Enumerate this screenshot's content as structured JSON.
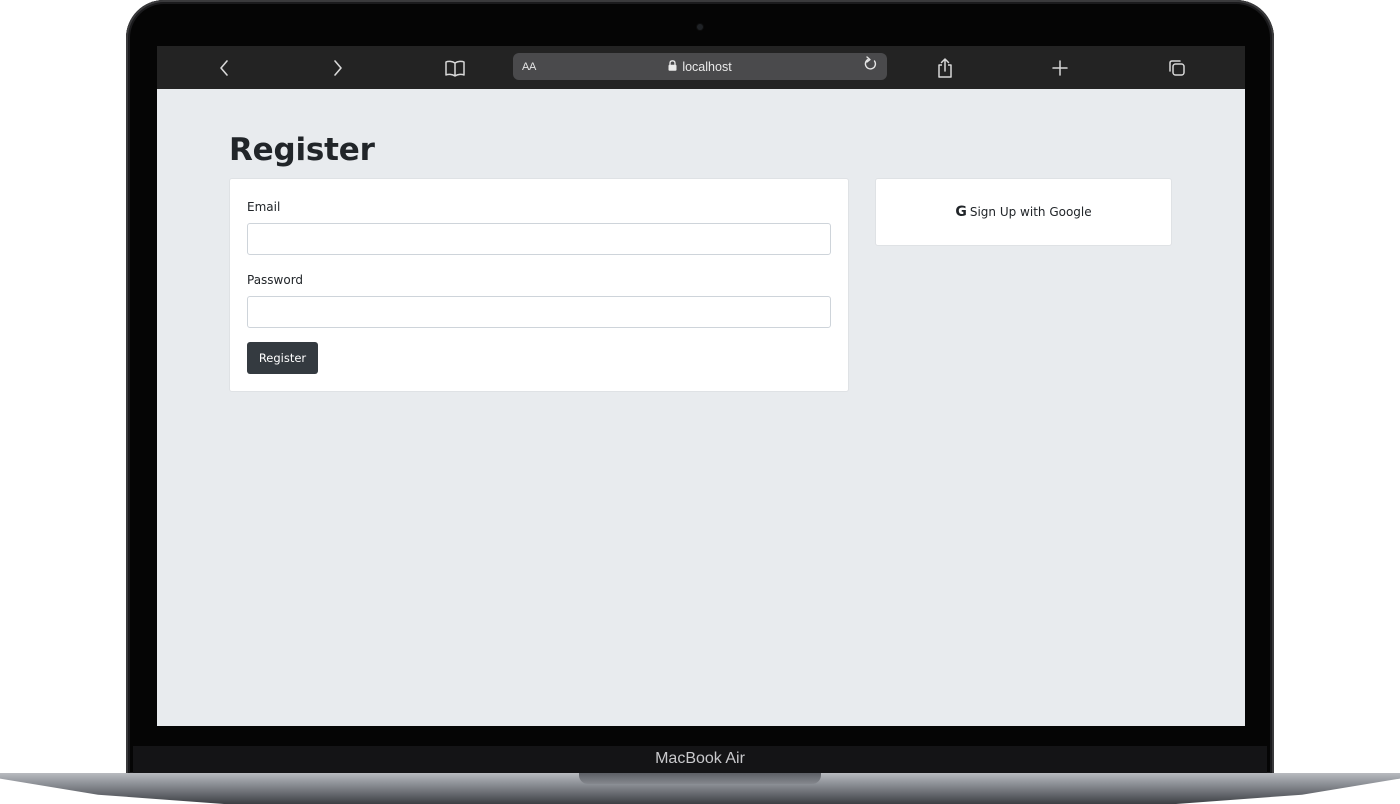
{
  "device": {
    "model_label": "MacBook Air"
  },
  "browser": {
    "text_size_label": "AA",
    "url": "localhost",
    "icons": {
      "back": "chevron-left-icon",
      "forward": "chevron-right-icon",
      "bookmarks": "book-icon",
      "lock": "lock-icon",
      "reload": "reload-icon",
      "share": "share-icon",
      "new_tab": "plus-icon",
      "tabs": "tabs-icon"
    }
  },
  "page": {
    "title": "Register",
    "form": {
      "email_label": "Email",
      "email_value": "",
      "password_label": "Password",
      "password_value": "",
      "submit_label": "Register"
    },
    "google": {
      "icon_glyph": "G",
      "label": "Sign Up with Google"
    }
  },
  "colors": {
    "page_background": "#e8ebee",
    "toolbar": "#232323",
    "primary_button": "#343a40",
    "text": "#212529"
  }
}
